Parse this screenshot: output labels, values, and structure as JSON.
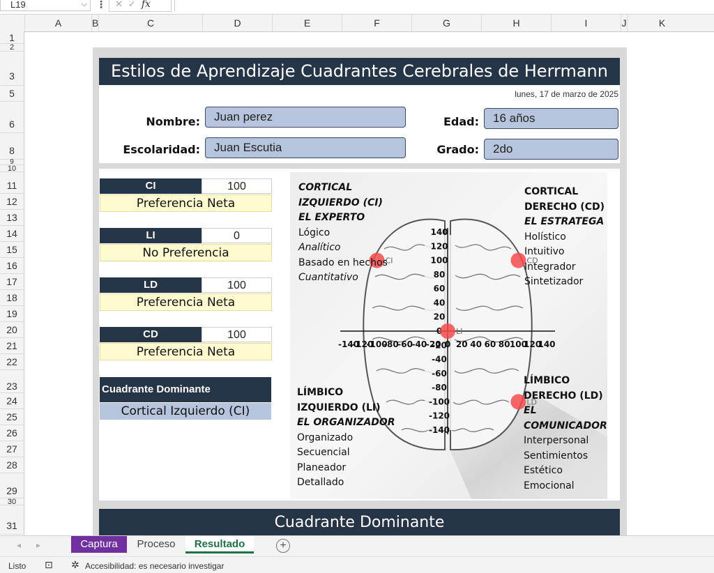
{
  "formula_bar": {
    "cell_ref": "L19",
    "fx": "fx"
  },
  "columns": [
    "A",
    "B",
    "C",
    "D",
    "E",
    "F",
    "G",
    "H",
    "I",
    "J",
    "K"
  ],
  "rows": [
    "1",
    "2",
    "3",
    "5",
    "6",
    "8",
    "9",
    "10",
    "11",
    "12",
    "13",
    "14",
    "15",
    "16",
    "17",
    "18",
    "19",
    "20",
    "21",
    "22",
    "23",
    "24",
    "25",
    "26",
    "27",
    "28",
    "29",
    "30",
    "31"
  ],
  "sheet": {
    "title": "Estilos de Aprendizaje Cuadrantes Cerebrales de Herrmann",
    "date": "lunes, 17 de marzo de 2025",
    "labels": {
      "nombre": "Nombre:",
      "edad": "Edad:",
      "escolaridad": "Escolaridad:",
      "grado": "Grado:"
    },
    "values": {
      "nombre": "Juan perez",
      "edad": "16 años",
      "escolaridad": "Juan Escutia",
      "grado": "2do"
    },
    "scores": [
      {
        "code": "CI",
        "value": "100",
        "pref": "Preferencia Neta"
      },
      {
        "code": "LI",
        "value": "0",
        "pref": "No Preferencia"
      },
      {
        "code": "LD",
        "value": "100",
        "pref": "Preferencia Neta"
      },
      {
        "code": "CD",
        "value": "100",
        "pref": "Preferencia Neta"
      }
    ],
    "dominant_label": "Cuadrante Dominante",
    "dominant_value": "Cortical Izquierdo (CI)",
    "bottom_title": "Cuadrante Dominante"
  },
  "quadrants": {
    "ci": {
      "h1": "CORTICAL",
      "h2": "IZQUIERDO (CI)",
      "h3": "EL EXPERTO",
      "items": [
        "Lógico",
        "Analítico",
        "Basado en hechos",
        "Cuantitativo"
      ]
    },
    "cd": {
      "h1": "CORTICAL",
      "h2": "DERECHO (CD)",
      "h3": "EL ESTRATEGA",
      "items": [
        "Holístico",
        "Intuitivo",
        "Integrador",
        "Sintetizador"
      ]
    },
    "li": {
      "h1": "LÍMBICO",
      "h2": "IZQUIERDO (LI)",
      "h3": "EL ORGANIZADOR",
      "items": [
        "Organizado",
        "Secuencial",
        "Planeador",
        "Detallado"
      ]
    },
    "ld": {
      "h1": "LÍMBICO",
      "h2": "DERECHO (LD)",
      "h3a": "EL",
      "h3b": "COMUNICADOR",
      "items": [
        "Interpersonal",
        "Sentimientos",
        "Estético",
        "Emocional"
      ]
    }
  },
  "chart_data": {
    "type": "scatter",
    "x_ticks": [
      "-140",
      "-120",
      "-100",
      "-80",
      "-60",
      "-40",
      "-20",
      "0",
      "20",
      "40",
      "60",
      "80",
      "100",
      "120",
      "140"
    ],
    "y_ticks": [
      "140",
      "120",
      "100",
      "80",
      "60",
      "40",
      "20",
      "0",
      "-20",
      "-40",
      "-60",
      "-80",
      "-100",
      "-120",
      "-140"
    ],
    "xlim": [
      -140,
      140
    ],
    "ylim": [
      -140,
      140
    ],
    "points": [
      {
        "label": "CI",
        "x": -100,
        "y": 100
      },
      {
        "label": "CD",
        "x": 100,
        "y": 100
      },
      {
        "label": "LI",
        "x": 0,
        "y": 0
      },
      {
        "label": "LD",
        "x": 100,
        "y": -100
      }
    ],
    "point_color": "#f44b4b"
  },
  "tabs": [
    {
      "label": "Captura",
      "color": "#7030a0"
    },
    {
      "label": "Proceso",
      "color": ""
    },
    {
      "label": "Resultado",
      "color": "#1e7145"
    }
  ],
  "status": {
    "ready": "Listo",
    "accessibility": "Accesibilidad: es necesario investigar"
  }
}
